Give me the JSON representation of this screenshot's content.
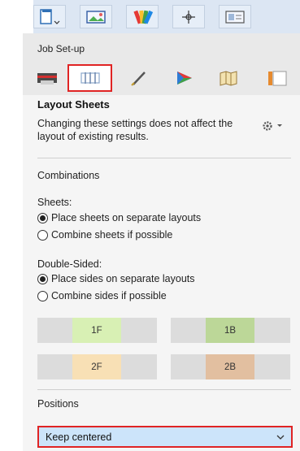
{
  "toolbar": {
    "icons": [
      "document-dropdown-icon",
      "image-icon",
      "color-swatches-icon",
      "crosshair-icon",
      "card-icon"
    ]
  },
  "job_setup": {
    "label": "Job Set-up",
    "tabs": [
      "printer-icon",
      "layout-sheets-icon",
      "pen-icon",
      "color-triangle-icon",
      "map-icon",
      "book-icon"
    ],
    "selected_tab": "layout-sheets-icon"
  },
  "panel": {
    "title": "Layout Sheets",
    "description": "Changing these settings does not affect the layout of existing results.",
    "combinations_label": "Combinations",
    "sheets": {
      "label": "Sheets:",
      "options": [
        "Place sheets on separate layouts",
        "Combine sheets if possible"
      ],
      "selected": "Place sheets on separate layouts"
    },
    "double_sided": {
      "label": "Double-Sided:",
      "options": [
        "Place sides on separate layouts",
        "Combine sides if possible"
      ],
      "selected": "Place sides on separate layouts"
    },
    "preview": {
      "cells": [
        "1F",
        "1B",
        "2F",
        "2B"
      ],
      "colors": [
        "#d8f0b4",
        "#bcd798",
        "#f8e0b5",
        "#e2bfa0"
      ]
    },
    "positions": {
      "label": "Positions",
      "value": "Keep centered"
    }
  }
}
